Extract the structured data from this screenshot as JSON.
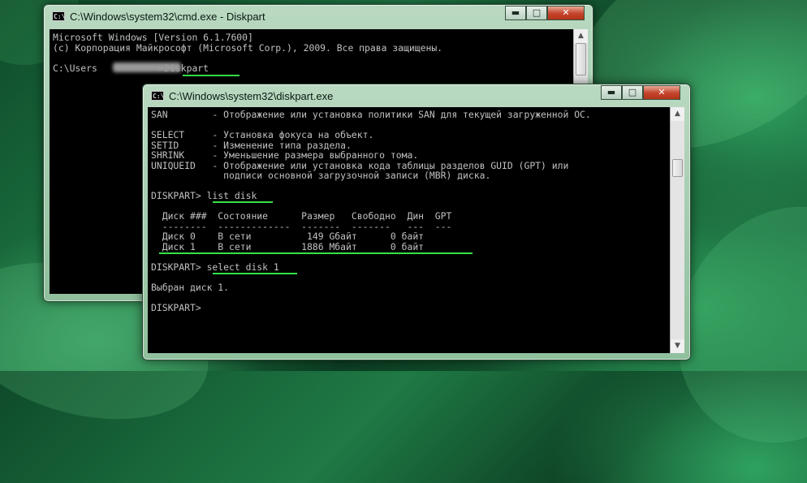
{
  "colors": {
    "console_bg": "#000000",
    "console_text": "#c0c0c0",
    "underline": "#35e24a"
  },
  "back_window": {
    "title": "C:\\Windows\\system32\\cmd.exe - Diskpart",
    "icon_label": "C:\\",
    "lines": [
      "Microsoft Windows [Version 6.1.7600]",
      "(c) Корпорация Майкрософт (Microsoft Corp.), 2009. Все права защищены.",
      "",
      "C:\\Users           >Diskpart"
    ]
  },
  "front_window": {
    "title": "C:\\Windows\\system32\\diskpart.exe",
    "icon_label": "C:\\",
    "lines": [
      "SAN        - Отображение или установка политики SAN для текущей загруженной ОС.",
      "",
      "SELECT     - Установка фокуса на объект.",
      "SETID      - Изменение типа раздела.",
      "SHRINK     - Уменьшение размера выбранного тома.",
      "UNIQUEID   - Отображение или установка кода таблицы разделов GUID (GPT) или",
      "             подписи основной загрузочной записи (MBR) диска.",
      "",
      "DISKPART> list disk",
      "",
      "  Диск ###  Состояние      Размер   Свободно  Дин  GPT",
      "  --------  -------------  -------  -------   ---  ---",
      "  Диск 0    В сети          149 Gбайт      0 байт",
      "  Диск 1    В сети         1886 Мбайт      0 байт",
      "",
      "DISKPART> select disk 1",
      "",
      "Выбран диск 1.",
      "",
      "DISKPART>"
    ]
  },
  "window_controls": {
    "minimize": "▬",
    "maximize": "□",
    "close": "✕"
  },
  "scrollbar": {
    "up": "▲",
    "down": "▼"
  }
}
